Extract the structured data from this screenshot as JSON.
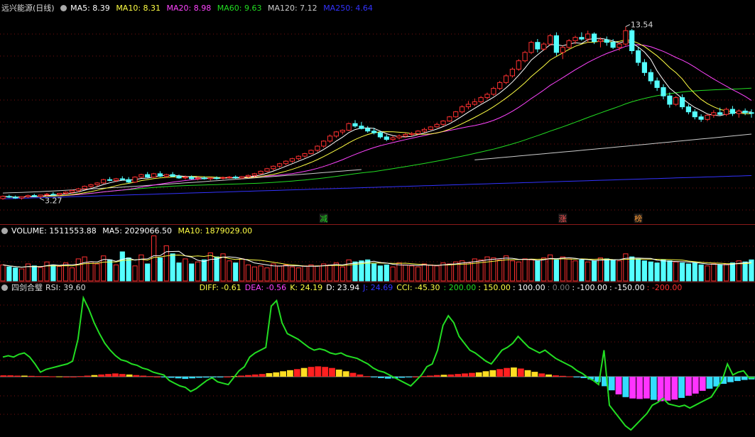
{
  "colors": {
    "up": "#ff3030",
    "down": "#54ffff",
    "ma5": "#ffffff",
    "ma10": "#ffff44",
    "ma20": "#ff44ff",
    "ma60": "#22dd22",
    "ma120": "#cccccc",
    "ma250": "#3333ff",
    "rsi": "#22dd22"
  },
  "price_panel": {
    "title": "远兴能源(日线)",
    "ma5": "MA5: 8.39",
    "ma10": "MA10: 8.31",
    "ma20": "MA20: 8.98",
    "ma60": "MA60: 9.63",
    "ma120": "MA120: 7.12",
    "ma250": "MA250: 4.64",
    "high_label": "13.54",
    "low_label": "3.27",
    "signals": [
      "减",
      "涨",
      "榜"
    ]
  },
  "volume_panel": {
    "vol": "VOLUME: 1511553.88",
    "ma5": "MA5: 2029066.50",
    "ma10": "MA10: 1879029.00"
  },
  "indicator_panel": {
    "name": "四剑合璧",
    "rsi": "RSI: 39.60",
    "diff": "DIFF: -0.61",
    "dea": "DEA: -0.56",
    "k": "K: 24.19",
    "d": "D: 23.94",
    "j": "J: 24.69",
    "cci": "CCI: -45.30",
    "levels": [
      ": 200.00",
      ": 150.00",
      ": 100.00",
      ": 0.00",
      ": -100.00",
      ": -150.00",
      ": -200.00"
    ]
  },
  "chart_data": {
    "type": "candlestick",
    "price_range": [
      2.5,
      14.2
    ],
    "ohlc": [
      [
        3.27,
        3.45,
        3.2,
        3.4
      ],
      [
        3.4,
        3.5,
        3.3,
        3.35
      ],
      [
        3.35,
        3.45,
        3.25,
        3.3
      ],
      [
        3.3,
        3.4,
        3.2,
        3.38
      ],
      [
        3.38,
        3.5,
        3.3,
        3.45
      ],
      [
        3.45,
        3.55,
        3.35,
        3.4
      ],
      [
        3.4,
        3.5,
        3.3,
        3.48
      ],
      [
        3.48,
        3.6,
        3.4,
        3.52
      ],
      [
        3.52,
        3.65,
        3.45,
        3.5
      ],
      [
        3.5,
        3.6,
        3.4,
        3.58
      ],
      [
        3.58,
        3.7,
        3.5,
        3.65
      ],
      [
        3.65,
        3.8,
        3.55,
        3.75
      ],
      [
        3.75,
        3.9,
        3.65,
        3.85
      ],
      [
        3.85,
        4.05,
        3.8,
        4.0
      ],
      [
        4.0,
        4.15,
        3.9,
        4.1
      ],
      [
        4.1,
        4.25,
        4.0,
        4.2
      ],
      [
        4.2,
        4.45,
        4.15,
        4.4
      ],
      [
        4.4,
        4.55,
        4.3,
        4.35
      ],
      [
        4.35,
        4.5,
        4.25,
        4.45
      ],
      [
        4.45,
        4.6,
        4.35,
        4.4
      ],
      [
        4.4,
        4.55,
        4.2,
        4.25
      ],
      [
        4.25,
        4.6,
        4.2,
        4.55
      ],
      [
        4.55,
        4.75,
        4.5,
        4.7
      ],
      [
        4.7,
        4.85,
        4.5,
        4.55
      ],
      [
        4.55,
        4.8,
        4.5,
        4.75
      ],
      [
        4.75,
        4.9,
        4.55,
        4.6
      ],
      [
        4.6,
        4.75,
        4.5,
        4.7
      ],
      [
        4.7,
        4.85,
        4.55,
        4.6
      ],
      [
        4.6,
        4.7,
        4.45,
        4.5
      ],
      [
        4.5,
        4.65,
        4.4,
        4.55
      ],
      [
        4.55,
        4.65,
        4.4,
        4.45
      ],
      [
        4.45,
        4.6,
        4.35,
        4.5
      ],
      [
        4.5,
        4.6,
        4.4,
        4.45
      ],
      [
        4.45,
        4.55,
        4.35,
        4.5
      ],
      [
        4.5,
        4.6,
        4.4,
        4.48
      ],
      [
        4.48,
        4.58,
        4.4,
        4.52
      ],
      [
        4.52,
        4.62,
        4.45,
        4.55
      ],
      [
        4.55,
        4.65,
        4.45,
        4.5
      ],
      [
        4.5,
        4.62,
        4.42,
        4.58
      ],
      [
        4.58,
        4.7,
        4.5,
        4.65
      ],
      [
        4.65,
        4.8,
        4.55,
        4.75
      ],
      [
        4.75,
        4.95,
        4.7,
        4.9
      ],
      [
        4.9,
        5.1,
        4.85,
        5.05
      ],
      [
        5.05,
        5.25,
        4.95,
        5.2
      ],
      [
        5.2,
        5.4,
        5.1,
        5.35
      ],
      [
        5.35,
        5.55,
        5.25,
        5.5
      ],
      [
        5.5,
        5.7,
        5.4,
        5.65
      ],
      [
        5.65,
        5.85,
        5.55,
        5.8
      ],
      [
        5.8,
        6.0,
        5.7,
        5.95
      ],
      [
        5.95,
        6.2,
        5.9,
        6.15
      ],
      [
        6.15,
        6.45,
        6.05,
        6.4
      ],
      [
        6.4,
        6.75,
        6.3,
        6.7
      ],
      [
        6.7,
        7.1,
        6.6,
        7.0
      ],
      [
        7.0,
        7.3,
        6.9,
        7.25
      ],
      [
        7.25,
        7.4,
        7.1,
        7.35
      ],
      [
        7.35,
        7.8,
        7.3,
        7.75
      ],
      [
        7.75,
        7.95,
        7.5,
        7.6
      ],
      [
        7.6,
        7.85,
        7.4,
        7.45
      ],
      [
        7.45,
        7.6,
        7.2,
        7.3
      ],
      [
        7.3,
        7.5,
        7.1,
        7.2
      ],
      [
        7.2,
        7.3,
        6.85,
        6.95
      ],
      [
        6.95,
        7.1,
        6.7,
        6.8
      ],
      [
        6.8,
        7.0,
        6.7,
        6.9
      ],
      [
        6.9,
        7.1,
        6.8,
        7.0
      ],
      [
        7.0,
        7.2,
        6.9,
        7.1
      ],
      [
        7.1,
        7.25,
        7.0,
        7.15
      ],
      [
        7.15,
        7.35,
        7.05,
        7.3
      ],
      [
        7.3,
        7.5,
        7.2,
        7.4
      ],
      [
        7.4,
        7.6,
        7.35,
        7.55
      ],
      [
        7.55,
        7.8,
        7.5,
        7.7
      ],
      [
        7.7,
        7.95,
        7.6,
        7.9
      ],
      [
        7.9,
        8.2,
        7.85,
        8.15
      ],
      [
        8.15,
        8.5,
        8.1,
        8.45
      ],
      [
        8.45,
        8.85,
        8.35,
        8.75
      ],
      [
        8.75,
        9.1,
        8.6,
        8.9
      ],
      [
        8.9,
        9.25,
        8.8,
        9.05
      ],
      [
        9.05,
        9.4,
        8.95,
        9.3
      ],
      [
        9.3,
        9.6,
        9.2,
        9.5
      ],
      [
        9.5,
        9.95,
        9.4,
        9.85
      ],
      [
        9.85,
        10.3,
        9.75,
        10.2
      ],
      [
        10.2,
        10.7,
        10.1,
        10.6
      ],
      [
        10.6,
        11.1,
        10.5,
        11.0
      ],
      [
        11.0,
        11.6,
        10.9,
        11.5
      ],
      [
        11.5,
        12.1,
        11.4,
        12.0
      ],
      [
        12.0,
        12.7,
        11.9,
        12.6
      ],
      [
        12.6,
        12.8,
        12.0,
        12.2
      ],
      [
        12.2,
        12.6,
        12.1,
        12.5
      ],
      [
        12.5,
        13.1,
        12.4,
        13.0
      ],
      [
        13.0,
        13.2,
        11.8,
        12.0
      ],
      [
        12.0,
        12.4,
        11.6,
        12.3
      ],
      [
        12.3,
        12.8,
        12.2,
        12.7
      ],
      [
        12.7,
        13.0,
        12.5,
        12.9
      ],
      [
        12.9,
        13.2,
        12.7,
        12.8
      ],
      [
        12.8,
        13.3,
        12.6,
        13.1
      ],
      [
        13.1,
        13.2,
        12.5,
        12.65
      ],
      [
        12.65,
        12.9,
        12.3,
        12.75
      ],
      [
        12.75,
        12.95,
        12.4,
        12.6
      ],
      [
        12.6,
        12.8,
        12.2,
        12.3
      ],
      [
        12.3,
        12.6,
        12.1,
        12.5
      ],
      [
        12.5,
        13.54,
        12.4,
        13.3
      ],
      [
        13.3,
        13.4,
        11.9,
        12.1
      ],
      [
        12.1,
        12.3,
        11.2,
        11.4
      ],
      [
        11.4,
        11.6,
        10.6,
        10.8
      ],
      [
        10.8,
        11.0,
        10.1,
        10.3
      ],
      [
        10.3,
        10.5,
        9.7,
        9.9
      ],
      [
        9.9,
        10.1,
        9.2,
        9.4
      ],
      [
        9.4,
        9.6,
        8.7,
        8.9
      ],
      [
        8.9,
        9.4,
        8.8,
        9.3
      ],
      [
        9.3,
        9.5,
        8.6,
        8.75
      ],
      [
        8.75,
        8.9,
        8.3,
        8.45
      ],
      [
        8.45,
        8.6,
        8.0,
        8.15
      ],
      [
        8.15,
        8.3,
        7.85,
        8.0
      ],
      [
        8.0,
        8.3,
        7.9,
        8.25
      ],
      [
        8.25,
        8.55,
        8.1,
        8.4
      ],
      [
        8.4,
        8.7,
        8.2,
        8.3
      ],
      [
        8.3,
        8.7,
        8.2,
        8.6
      ],
      [
        8.6,
        8.8,
        8.2,
        8.35
      ],
      [
        8.35,
        8.6,
        8.1,
        8.5
      ],
      [
        8.5,
        8.65,
        8.25,
        8.4
      ],
      [
        8.4,
        8.6,
        8.1,
        8.39
      ]
    ],
    "volume_range": [
      0,
      4600000
    ],
    "volume": [
      1600000,
      1400000,
      1300000,
      1200000,
      1700000,
      1500000,
      1350000,
      1900000,
      1600000,
      1450000,
      1800000,
      1300000,
      2200000,
      2400000,
      1900000,
      1700000,
      2500000,
      2100000,
      1600000,
      2900000,
      2300000,
      1500000,
      2600000,
      1700000,
      4500000,
      2300000,
      3500000,
      2700000,
      1800000,
      2200000,
      1700000,
      1900000,
      2100000,
      2800000,
      2400000,
      2700000,
      2000000,
      1800000,
      2200000,
      1600000,
      1400000,
      1500000,
      1300000,
      1700000,
      1500000,
      1600000,
      1400000,
      1300000,
      1500000,
      1600000,
      1500000,
      1700000,
      1600000,
      1800000,
      1400000,
      2100000,
      1900000,
      2000000,
      2100000,
      1700000,
      1500000,
      1600000,
      1400000,
      1800000,
      1600000,
      1500000,
      1400000,
      1700000,
      1600000,
      1500000,
      1800000,
      1700000,
      1900000,
      2000000,
      1800000,
      2200000,
      2100000,
      2400000,
      2300000,
      2100000,
      2500000,
      2000000,
      1900000,
      2200000,
      2100000,
      2000000,
      2300000,
      2600000,
      2100000,
      2400000,
      2200000,
      2000000,
      2100000,
      1900000,
      2000000,
      2300000,
      2200000,
      2100000,
      2000000,
      2700000,
      2400000,
      2200000,
      2000000,
      1900000,
      1800000,
      2100000,
      2000000,
      1900000,
      1800000,
      1700000,
      1800000,
      1600000,
      1500000,
      1700000,
      1600000,
      1700000,
      1800000,
      2000000,
      1900000,
      2100000,
      2000000,
      1700000,
      1500000,
      1600000
    ],
    "rsi_range": [
      0,
      100
    ],
    "rsi": [
      55,
      56,
      55,
      57,
      58,
      55,
      50,
      44,
      46,
      47,
      48,
      49,
      50,
      52,
      68,
      98,
      90,
      80,
      72,
      65,
      60,
      56,
      53,
      52,
      50,
      49,
      47,
      46,
      44,
      43,
      42,
      38,
      36,
      34,
      33,
      30,
      32,
      35,
      38,
      40,
      37,
      36,
      35,
      40,
      45,
      48,
      55,
      58,
      60,
      62,
      92,
      96,
      80,
      72,
      70,
      68,
      65,
      62,
      60,
      61,
      60,
      58,
      57,
      58,
      56,
      55,
      54,
      52,
      50,
      47,
      45,
      44,
      42,
      40,
      38,
      36,
      34,
      38,
      42,
      48,
      50,
      60,
      78,
      85,
      80,
      70,
      65,
      60,
      58,
      55,
      52,
      50,
      55,
      60,
      62,
      65,
      70,
      66,
      62,
      60,
      58,
      60,
      57,
      54,
      52,
      50,
      48,
      45,
      43,
      40,
      38,
      35,
      60,
      20,
      15,
      10,
      5,
      2,
      6,
      10,
      14,
      20,
      22,
      25,
      21,
      20,
      19,
      20,
      18,
      20,
      22,
      24,
      26,
      32,
      38,
      50,
      42,
      44,
      45,
      40,
      40
    ],
    "macd_range": [
      -1.2,
      0.6
    ],
    "macd": [
      0.05,
      0.05,
      0.04,
      0.04,
      0.03,
      0.02,
      0.02,
      0.01,
      0.01,
      0.0,
      0.0,
      0.02,
      0.04,
      0.06,
      0.08,
      0.1,
      0.12,
      0.1,
      0.08,
      0.06,
      0.04,
      0.02,
      0.0,
      -0.02,
      -0.04,
      -0.06,
      -0.08,
      -0.06,
      -0.04,
      -0.03,
      -0.02,
      -0.01,
      0.0,
      0.02,
      0.04,
      0.06,
      0.08,
      0.1,
      0.13,
      0.16,
      0.2,
      0.24,
      0.28,
      0.32,
      0.36,
      0.38,
      0.36,
      0.32,
      0.26,
      0.2,
      0.14,
      0.08,
      0.02,
      -0.02,
      -0.05,
      -0.07,
      -0.06,
      -0.04,
      -0.02,
      0.0,
      0.02,
      0.04,
      0.06,
      0.07,
      0.08,
      0.1,
      0.12,
      0.14,
      0.16,
      0.2,
      0.24,
      0.28,
      0.32,
      0.34,
      0.3,
      0.24,
      0.18,
      0.12,
      0.08,
      0.05,
      0.03,
      0.01,
      -0.02,
      -0.05,
      -0.1,
      -0.2,
      -0.35,
      -0.5,
      -0.65,
      -0.75,
      -0.8,
      -0.82,
      -0.8,
      -0.85,
      -0.9,
      -0.88,
      -0.84,
      -0.78,
      -0.7,
      -0.62,
      -0.52,
      -0.44,
      -0.36,
      -0.26,
      -0.2,
      -0.16,
      -0.12,
      -0.1
    ],
    "ma_endpoints": {
      "ma5": 8.39,
      "ma10": 8.31,
      "ma20": 8.98,
      "ma60": 9.63,
      "ma120": 7.12,
      "ma250": 4.64
    }
  }
}
